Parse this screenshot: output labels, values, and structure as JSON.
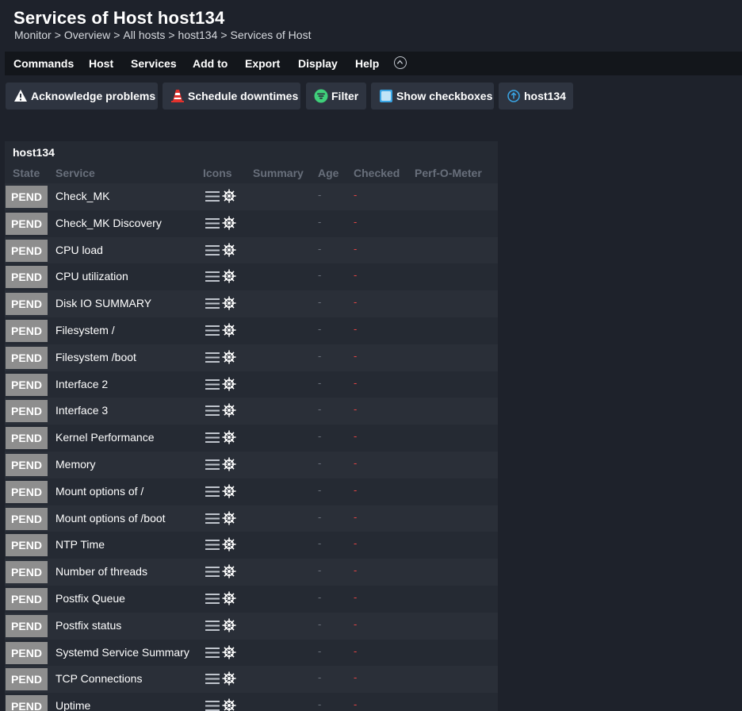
{
  "header": {
    "title": "Services of Host host134",
    "breadcrumb": [
      "Monitor",
      "Overview",
      "All hosts",
      "host134",
      "Services of Host"
    ],
    "breadcrumb_separator": ">"
  },
  "menu": {
    "items": [
      "Commands",
      "Host",
      "Services",
      "Add to",
      "Export",
      "Display",
      "Help"
    ],
    "collapse_icon": "chevron-up-circle-icon"
  },
  "toolbar": {
    "buttons": [
      {
        "label": "Acknowledge problems",
        "icon": "warning-icon"
      },
      {
        "label": "Schedule downtimes",
        "icon": "traffic-cone-icon"
      },
      {
        "label": "Filter",
        "icon": "filter-icon"
      },
      {
        "label": "Show checkboxes",
        "icon": "checkbox-icon"
      },
      {
        "label": "host134",
        "icon": "host-up-icon"
      }
    ]
  },
  "table": {
    "host": "host134",
    "columns": [
      "State",
      "Service",
      "Icons",
      "Summary",
      "Age",
      "Checked",
      "Perf-O-Meter"
    ],
    "rows": [
      {
        "state": "PEND",
        "service": "Check_MK",
        "age": "-",
        "checked": "-"
      },
      {
        "state": "PEND",
        "service": "Check_MK Discovery",
        "age": "-",
        "checked": "-"
      },
      {
        "state": "PEND",
        "service": "CPU load",
        "age": "-",
        "checked": "-"
      },
      {
        "state": "PEND",
        "service": "CPU utilization",
        "age": "-",
        "checked": "-"
      },
      {
        "state": "PEND",
        "service": "Disk IO SUMMARY",
        "age": "-",
        "checked": "-"
      },
      {
        "state": "PEND",
        "service": "Filesystem /",
        "age": "-",
        "checked": "-"
      },
      {
        "state": "PEND",
        "service": "Filesystem /boot",
        "age": "-",
        "checked": "-"
      },
      {
        "state": "PEND",
        "service": "Interface 2",
        "age": "-",
        "checked": "-"
      },
      {
        "state": "PEND",
        "service": "Interface 3",
        "age": "-",
        "checked": "-"
      },
      {
        "state": "PEND",
        "service": "Kernel Performance",
        "age": "-",
        "checked": "-"
      },
      {
        "state": "PEND",
        "service": "Memory",
        "age": "-",
        "checked": "-"
      },
      {
        "state": "PEND",
        "service": "Mount options of /",
        "age": "-",
        "checked": "-"
      },
      {
        "state": "PEND",
        "service": "Mount options of /boot",
        "age": "-",
        "checked": "-"
      },
      {
        "state": "PEND",
        "service": "NTP Time",
        "age": "-",
        "checked": "-"
      },
      {
        "state": "PEND",
        "service": "Number of threads",
        "age": "-",
        "checked": "-"
      },
      {
        "state": "PEND",
        "service": "Postfix Queue",
        "age": "-",
        "checked": "-"
      },
      {
        "state": "PEND",
        "service": "Postfix status",
        "age": "-",
        "checked": "-"
      },
      {
        "state": "PEND",
        "service": "Systemd Service Summary",
        "age": "-",
        "checked": "-"
      },
      {
        "state": "PEND",
        "service": "TCP Connections",
        "age": "-",
        "checked": "-"
      },
      {
        "state": "PEND",
        "service": "Uptime",
        "age": "-",
        "checked": "-"
      }
    ],
    "row_icons": [
      "action-menu-icon",
      "helm-wheel-icon"
    ]
  },
  "colors": {
    "background": "#1e222b",
    "menubar": "#13161b",
    "panel": "#252a33",
    "pending": "#8e8e8e",
    "checked_dash": "#e84545",
    "filter_green": "#3fcf7a",
    "checkbox_blue": "#3aa5e4",
    "cone_red": "#e2322d"
  }
}
